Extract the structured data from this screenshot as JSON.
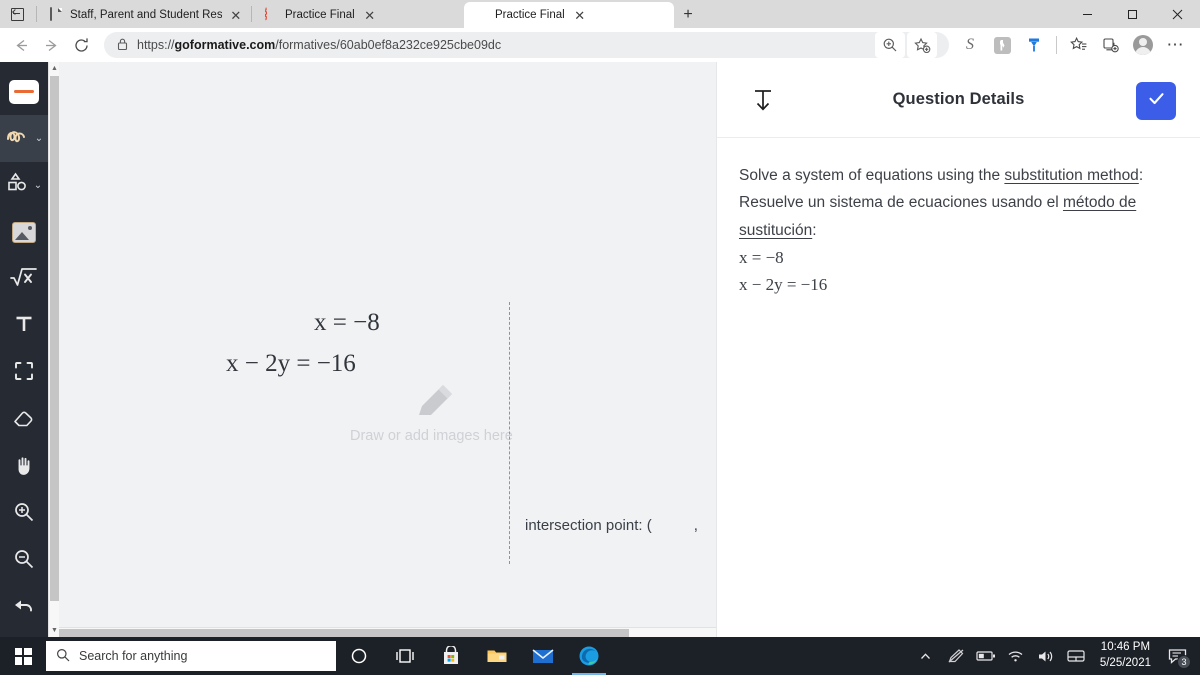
{
  "browser": {
    "tabs": [
      {
        "title": "Staff, Parent and Student Resour",
        "favicon": "document-icon",
        "active": false
      },
      {
        "title": "Practice Final",
        "favicon": "loading-spinner-icon",
        "active": false
      },
      {
        "title": "Practice Final",
        "favicon": "goformative-logo-icon",
        "active": true
      }
    ],
    "new_tab_label": "+",
    "close_label": "✕",
    "url_prefix": "https://",
    "url_domain": "goformative.com",
    "url_path": "/formatives/60ab0ef8a232ce925cbe09dc",
    "toolbar_icons": [
      "zoom-icon",
      "add-favorite-icon",
      "extension-s-icon",
      "extension-grammar-icon",
      "extension-badge-icon",
      "favorites-icon",
      "collections-icon",
      "profile-avatar-icon",
      "more-options-icon"
    ],
    "extension_s_label": "S",
    "more_label": "⋯",
    "window_controls": [
      "minimize",
      "maximize",
      "close"
    ]
  },
  "toolrail": {
    "items": [
      {
        "name": "stroke-color-swatch",
        "icon": "stroke-swatch-icon",
        "selected": false,
        "chevron": false
      },
      {
        "name": "pen-tool",
        "icon": "pen-squiggle-icon",
        "selected": true,
        "chevron": true
      },
      {
        "name": "shapes-tool",
        "icon": "shapes-icon",
        "selected": false,
        "chevron": true
      },
      {
        "name": "image-tool",
        "icon": "image-icon",
        "selected": false,
        "chevron": false
      },
      {
        "name": "math-tool",
        "icon": "square-root-icon",
        "selected": false,
        "chevron": false
      },
      {
        "name": "text-tool",
        "icon": "text-t-icon",
        "selected": false,
        "chevron": false
      },
      {
        "name": "select-tool",
        "icon": "selection-frame-icon",
        "selected": false,
        "chevron": false
      },
      {
        "name": "eraser-tool",
        "icon": "eraser-icon",
        "selected": false,
        "chevron": false
      },
      {
        "name": "pan-tool",
        "icon": "hand-icon",
        "selected": false,
        "chevron": false
      },
      {
        "name": "zoom-in-tool",
        "icon": "zoom-in-icon",
        "selected": false,
        "chevron": false
      },
      {
        "name": "zoom-out-tool",
        "icon": "zoom-out-icon",
        "selected": false,
        "chevron": false
      },
      {
        "name": "undo-tool",
        "icon": "undo-arrow-icon",
        "selected": false,
        "chevron": false
      }
    ],
    "chevron_glyph": "⌄"
  },
  "canvas": {
    "equation_1": "x = −8",
    "equation_2": "x − 2y = −16",
    "placeholder": "Draw or add images here",
    "intersection_label": "intersection point: (",
    "intersection_comma": ",",
    "intersection_close": ")"
  },
  "panel": {
    "title": "Question Details",
    "collapse_icon": "collapse-down-icon",
    "submit_icon": "checkmark-icon",
    "accent_color": "#3b5de7",
    "question": {
      "en_prefix": "Solve a system of equations using the ",
      "en_link": "substitution method",
      "en_suffix": ":",
      "es_prefix": "Resuelve un sistema de ecuaciones usando el ",
      "es_link": "método de sustitución",
      "es_suffix": ":",
      "equation_1": "x = −8",
      "equation_2": "x − 2y = −16"
    }
  },
  "taskbar": {
    "start_icon": "windows-start-icon",
    "search_placeholder": "Search for anything",
    "search_icon": "search-icon",
    "pinned": [
      {
        "name": "cortana-icon"
      },
      {
        "name": "task-view-icon"
      },
      {
        "name": "microsoft-store-icon"
      },
      {
        "name": "file-explorer-icon"
      },
      {
        "name": "mail-icon"
      },
      {
        "name": "edge-browser-icon"
      }
    ],
    "tray": [
      "show-hidden-icons-icon",
      "pen-disabled-icon",
      "battery-icon",
      "wifi-icon",
      "volume-icon",
      "touchpad-icon"
    ],
    "time": "10:46 PM",
    "date": "5/25/2021",
    "notification_icon": "notification-icon",
    "notification_count": "3"
  }
}
